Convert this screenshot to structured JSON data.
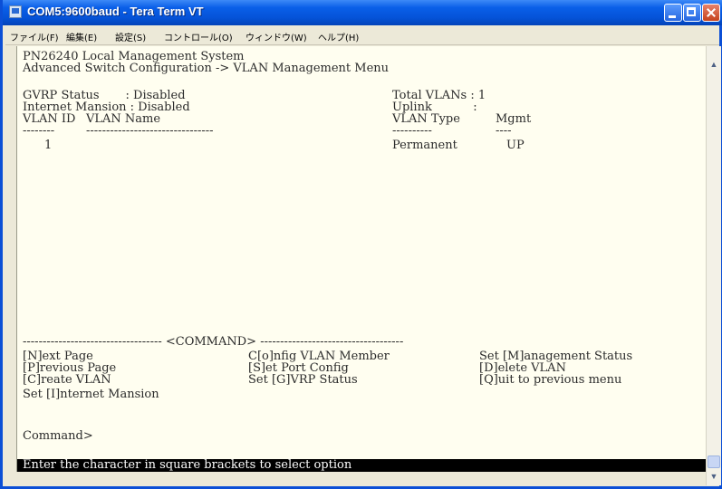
{
  "window": {
    "title": "COM5:9600baud - Tera Term VT"
  },
  "menubar": {
    "items": [
      "ファイル(F)",
      "編集(E)",
      "設定(S)",
      "コントロール(O)",
      "ウィンドウ(W)",
      "ヘルプ(H)"
    ]
  },
  "terminal": {
    "header_system": "PN26240 Local Management System",
    "header_path": "Advanced Switch Configuration -> VLAN Management Menu",
    "gvrp_label": "GVRP Status       : Disabled",
    "internet_mansion_label": "Internet Mansion : Disabled",
    "total_vlans_label": "Total VLANs : 1",
    "uplink_label": "Uplink           :",
    "col_vlan_id": "VLAN ID",
    "col_vlan_name": "VLAN Name",
    "col_vlan_type": "VLAN Type",
    "col_mgmt": "Mgmt",
    "sep_id": "--------",
    "sep_name": "--------------------------------",
    "sep_type": "----------",
    "sep_mgmt": "----",
    "rows": [
      {
        "id": "1",
        "name": "",
        "type": "Permanent",
        "mgmt": "UP"
      }
    ],
    "command_divider": "----------------------------------- <COMMAND> ------------------------------------",
    "commands": {
      "next_page": "[N]ext Page",
      "previous_page": "[P]revious Page",
      "create_vlan": "[C]reate VLAN",
      "set_internet_mansion": "Set [I]nternet Mansion",
      "config_vlan_member": "C[o]nfig VLAN Member",
      "set_port_config": "[S]et Port Config",
      "set_gvrp_status": "Set [G]VRP Status",
      "set_management_status": "Set [M]anagement Status",
      "delete_vlan": "[D]elete VLAN",
      "quit_previous": "[Q]uit to previous menu"
    },
    "prompt": "Command>",
    "status_hint": "Enter the character in square brackets to select option"
  }
}
